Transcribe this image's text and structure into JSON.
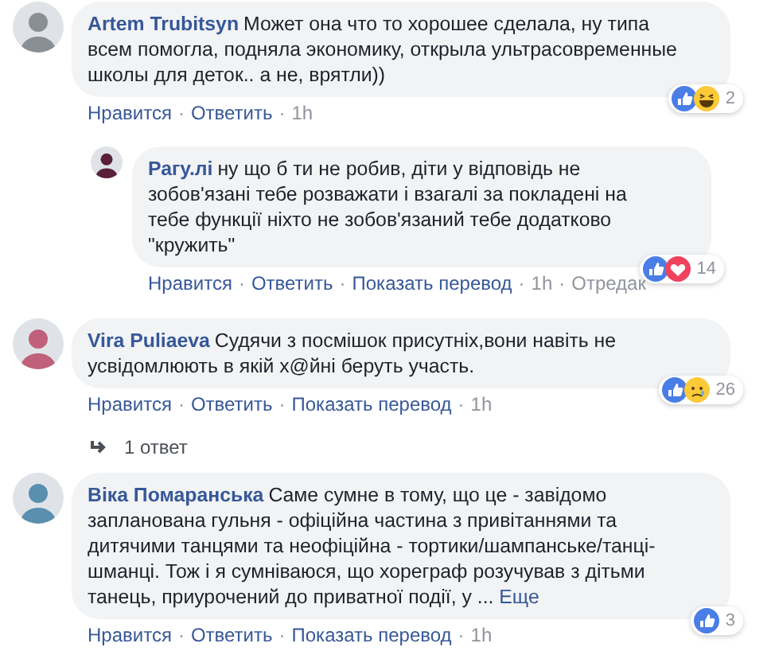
{
  "separator": "·",
  "comments": [
    {
      "author": "Artem Trubitsyn",
      "text": "Может она что то хорошее сделала, ну типа всем помогла, подняла экономику, открыла ультрасовременные школы для деток.. а не, врятли))",
      "reactions": [
        {
          "kind": "like"
        },
        {
          "kind": "haha"
        }
      ],
      "reaction_count": "2",
      "actions": [
        {
          "kind": "link",
          "label": "Нравится"
        },
        {
          "kind": "link",
          "label": "Ответить"
        },
        {
          "kind": "meta",
          "label": "1h"
        }
      ],
      "replies": [
        {
          "author": "Рагу.лі",
          "text": "ну що б ти не робив, діти у відповідь не зобов'язані тебе розважати і взагалі за покладені на тебе функції ніхто не зобов'язаний тебе додатково \"кружить\"",
          "reactions": [
            {
              "kind": "like"
            },
            {
              "kind": "love"
            }
          ],
          "reaction_count": "14",
          "actions": [
            {
              "kind": "link",
              "label": "Нравится"
            },
            {
              "kind": "link",
              "label": "Ответить"
            },
            {
              "kind": "link",
              "label": "Показать перевод"
            },
            {
              "kind": "meta",
              "label": "1h"
            },
            {
              "kind": "meta",
              "label": "Отредак"
            }
          ]
        }
      ]
    },
    {
      "author": "Vira Puliaeva",
      "text": "Судячи з посмішок присутніх,вони навіть не усвідомлюють в якій х@йні беруть участь.",
      "reactions": [
        {
          "kind": "like"
        },
        {
          "kind": "sad"
        }
      ],
      "reaction_count": "26",
      "actions": [
        {
          "kind": "link",
          "label": "Нравится"
        },
        {
          "kind": "link",
          "label": "Ответить"
        },
        {
          "kind": "link",
          "label": "Показать перевод"
        },
        {
          "kind": "meta",
          "label": "1h"
        }
      ],
      "replies_link": "1 ответ"
    },
    {
      "author": "Віка Помаранська",
      "text": "Саме сумне в тому, що це - завідомо запланована гульня - офіційна частина з привітаннями та дитячими танцями та неофіційна - тортики/шампанське/танці-шманці. Тож і я сумніваюся, що хореграф розучував з дітьми танець, приурочений до приватної події, у ...",
      "more": "Еще",
      "reactions": [
        {
          "kind": "like"
        }
      ],
      "reaction_count": "3",
      "actions": [
        {
          "kind": "link",
          "label": "Нравится"
        },
        {
          "kind": "link",
          "label": "Ответить"
        },
        {
          "kind": "link",
          "label": "Показать перевод"
        },
        {
          "kind": "meta",
          "label": "1h"
        }
      ]
    }
  ]
}
